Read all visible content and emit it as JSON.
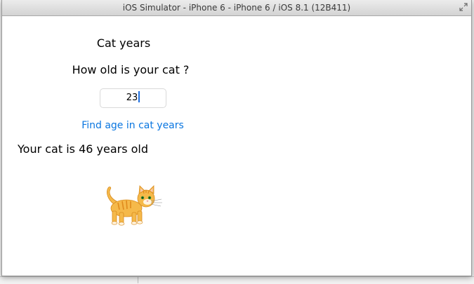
{
  "window": {
    "title": "iOS Simulator - iPhone 6 - iPhone 6 / iOS 8.1 (12B411)"
  },
  "app": {
    "heading": "Cat years",
    "question": "How old is your cat ?",
    "age_input": {
      "value": "23"
    },
    "find_button_label": "Find age in cat years",
    "result_text": "Your cat is 46 years old",
    "cat_image": "cat-illustration"
  },
  "colors": {
    "link": "#0a76e0",
    "caret": "#1e6fe0",
    "cat_fur": "#f5b94a"
  }
}
